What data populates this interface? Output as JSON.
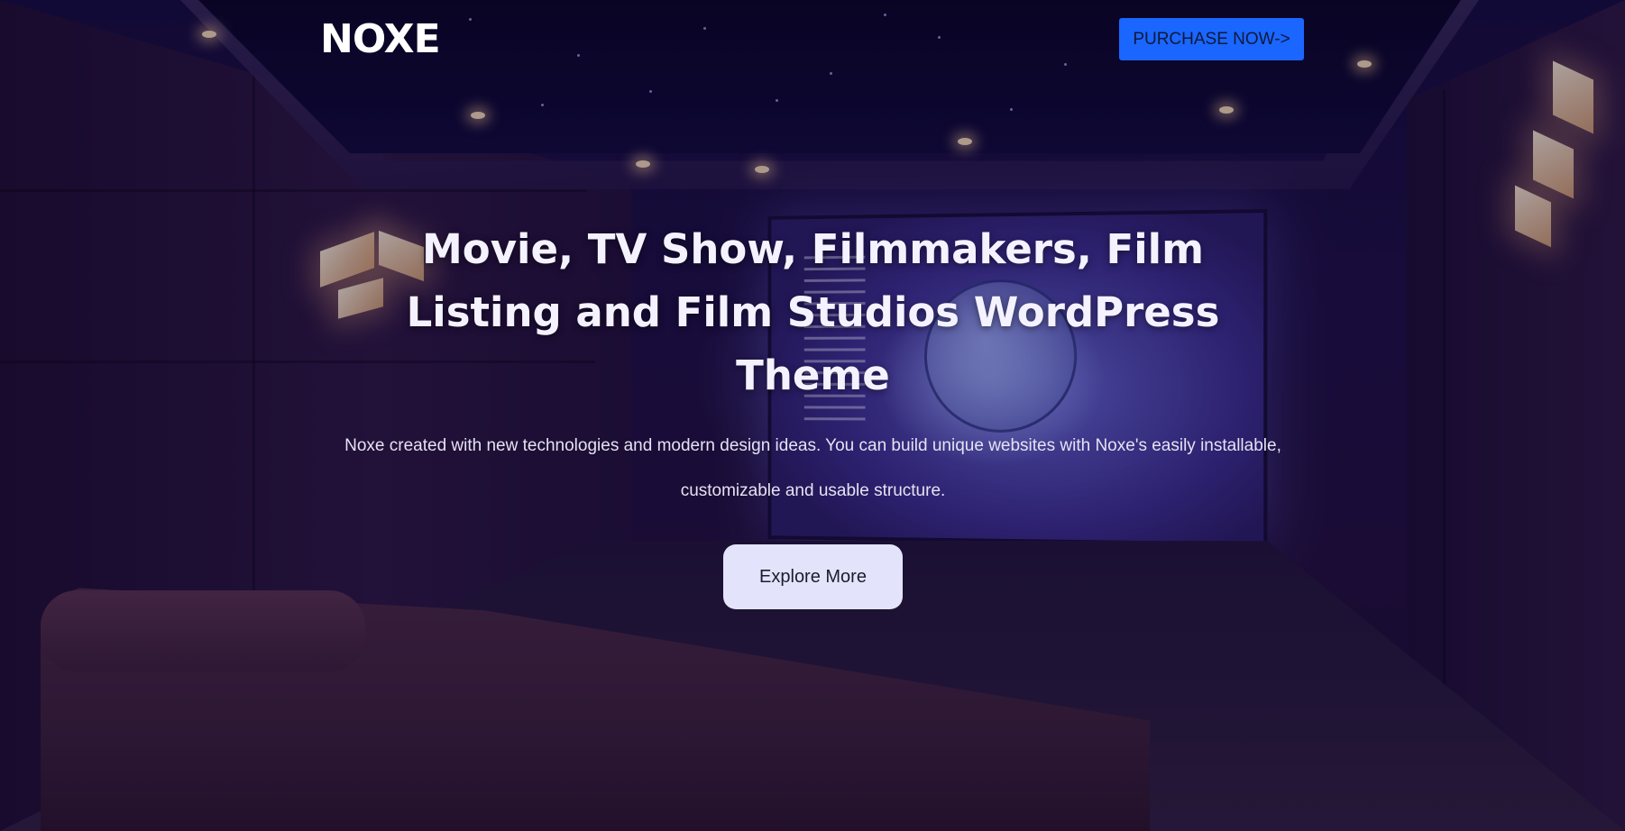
{
  "header": {
    "logo_text": "NOXE",
    "purchase_label": "PURCHASE NOW->"
  },
  "hero": {
    "title": "Movie, TV Show, Filmmakers, Film Listing and Film Studios WordPress Theme",
    "description": "Noxe created with new technologies and modern design ideas. You can build unique websites with Noxe's easily installable, customizable and usable structure.",
    "explore_label": "Explore More"
  },
  "colors": {
    "purchase_button": "#1a66ff",
    "explore_button": "#e3e4fb",
    "title_text": "#f5f2ff"
  }
}
